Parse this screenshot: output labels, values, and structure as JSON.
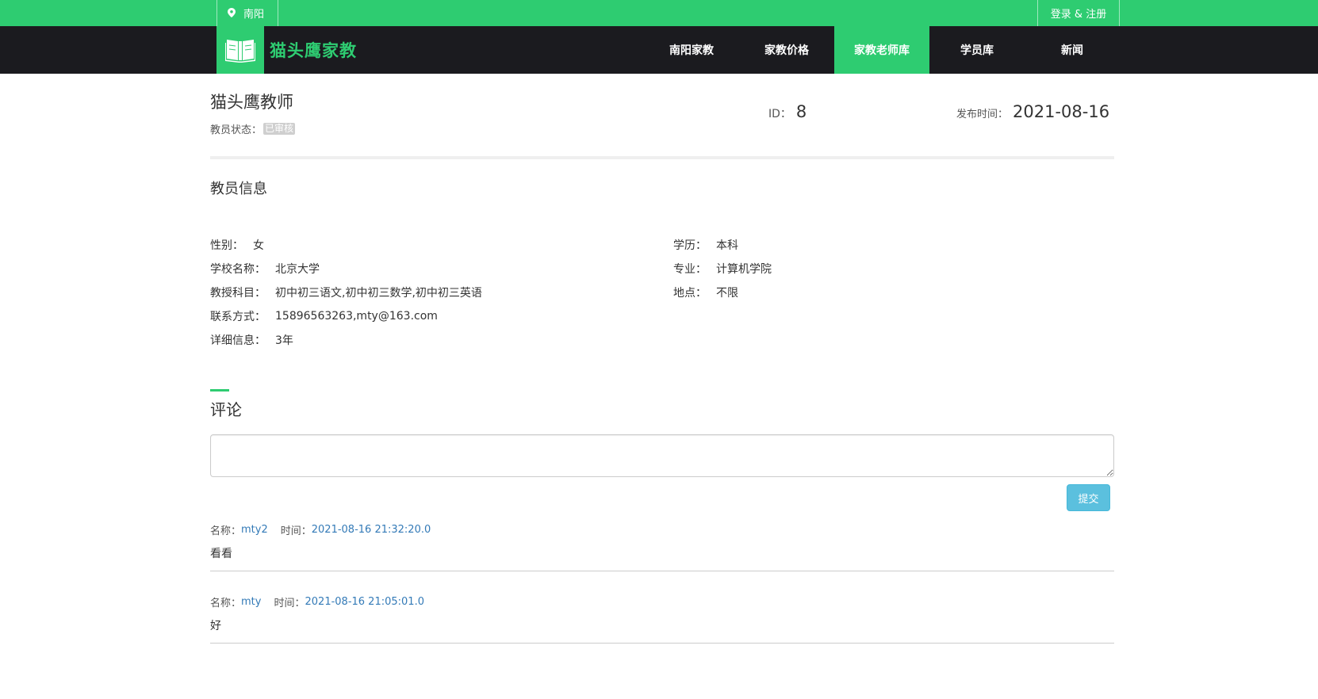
{
  "topbar": {
    "city": "南阳",
    "login": "登录 & 注册"
  },
  "brand": {
    "name": "猫头鹰家教"
  },
  "nav": [
    {
      "label": "南阳家教"
    },
    {
      "label": "家教价格"
    },
    {
      "label": "家教老师库"
    },
    {
      "label": "学员库"
    },
    {
      "label": "新闻"
    }
  ],
  "teacher": {
    "name": "猫头鹰教师",
    "status_label": "教员状态：",
    "status": "已审核",
    "id_label": "ID：",
    "id": "8",
    "date_label": "发布时间：",
    "date": "2021-08-16"
  },
  "info": {
    "title": "教员信息",
    "left": [
      {
        "k": "性别：",
        "v": "女"
      },
      {
        "k": "学校名称：",
        "v": "北京大学"
      },
      {
        "k": "教授科目：",
        "v": "初中初三语文,初中初三数学,初中初三英语"
      },
      {
        "k": "联系方式：",
        "v": "15896563263,mty@163.com"
      },
      {
        "k": "详细信息：",
        "v": "3年"
      }
    ],
    "right": [
      {
        "k": "学历：",
        "v": "本科"
      },
      {
        "k": "专业：",
        "v": "计算机学院"
      },
      {
        "k": "地点：",
        "v": "不限"
      }
    ]
  },
  "comments_section": {
    "title": "评论",
    "placeholder": "",
    "submit": "提交",
    "name_label": "名称：",
    "time_label": "时间：",
    "items": [
      {
        "name": "mty2",
        "time": "2021-08-16 21:32:20.0",
        "text": "看看"
      },
      {
        "name": "mty",
        "time": "2021-08-16 21:05:01.0",
        "text": "好"
      }
    ]
  },
  "colors": {
    "accent": "#2ecc71",
    "nav_bg": "#1b1b1f",
    "link": "#337ab7",
    "button": "#5bc0de"
  }
}
